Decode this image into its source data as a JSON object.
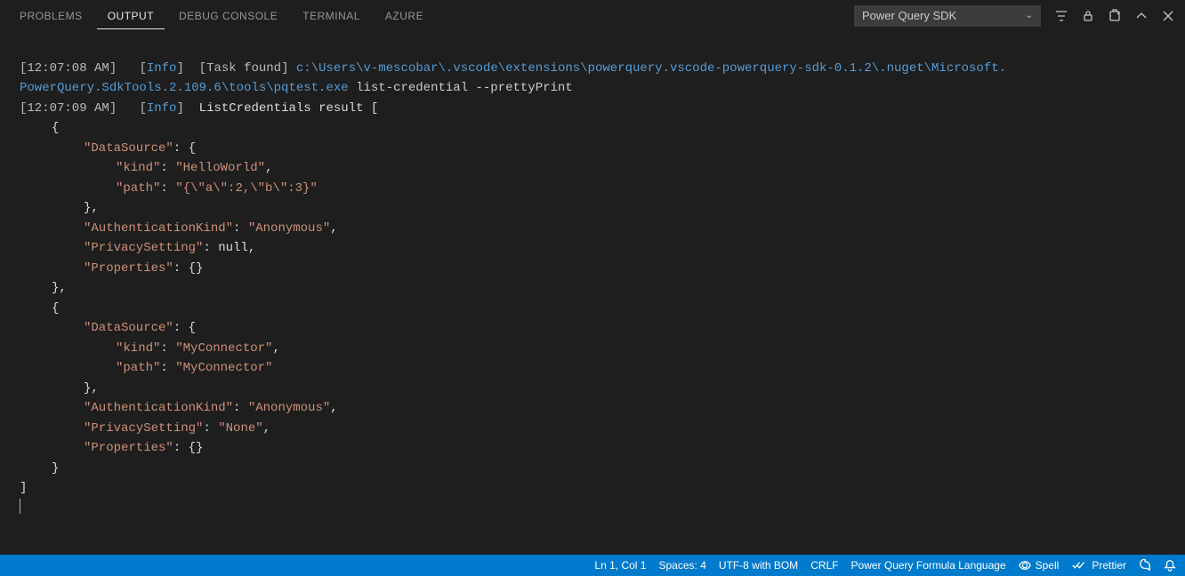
{
  "tabs": {
    "problems": "PROBLEMS",
    "output": "OUTPUT",
    "debug_console": "DEBUG CONSOLE",
    "terminal": "TERMINAL",
    "azure": "AZURE"
  },
  "filter": {
    "selected": "Power Query SDK"
  },
  "log": {
    "line1": {
      "ts": "[12:07:08 AM]",
      "info_open": "[",
      "info": "Info",
      "info_close": "]",
      "task_found": "[Task found]",
      "path_part1": "c:\\Users\\v-mescobar\\.vscode\\extensions\\powerquery.vscode-powerquery-sdk-0.1.2\\.nuget\\Microsoft.",
      "path_part2": "PowerQuery.SdkTools.2.109.6\\tools\\pqtest.exe",
      "cmd": " list-credential --prettyPrint"
    },
    "line2": {
      "ts": "[12:07:09 AM]",
      "info_open": "[",
      "info": "Info",
      "info_close": "]",
      "msg": "ListCredentials result ["
    },
    "json": {
      "open_brace_1": "{",
      "ds1_key": "\"DataSource\"",
      "colon_brace": ": {",
      "kind1_key": "\"kind\"",
      "kind1_val": "\"HelloWorld\"",
      "path1_key": "\"path\"",
      "path1_val": "\"{\\\"a\\\":2,\\\"b\\\":3}\"",
      "close_brace_comma": "},",
      "auth1_key": "\"AuthenticationKind\"",
      "auth1_val": "\"Anonymous\"",
      "priv1_key": "\"PrivacySetting\"",
      "priv1_val": "null",
      "props1_key": "\"Properties\"",
      "props1_val": ": {}",
      "obj_close_comma": "},",
      "open_brace_2": "{",
      "ds2_key": "\"DataSource\"",
      "kind2_key": "\"kind\"",
      "kind2_val": "\"MyConnector\"",
      "path2_key": "\"path\"",
      "path2_val": "\"MyConnector\"",
      "auth2_key": "\"AuthenticationKind\"",
      "auth2_val": "\"Anonymous\"",
      "priv2_key": "\"PrivacySetting\"",
      "priv2_val": "\"None\"",
      "props2_key": "\"Properties\"",
      "close_brace_2": "}",
      "array_close": "]"
    }
  },
  "statusbar": {
    "ln_col": "Ln 1, Col 1",
    "spaces": "Spaces: 4",
    "encoding": "UTF-8 with BOM",
    "eol": "CRLF",
    "language": "Power Query Formula Language",
    "spell": "Spell",
    "prettier": "Prettier"
  }
}
